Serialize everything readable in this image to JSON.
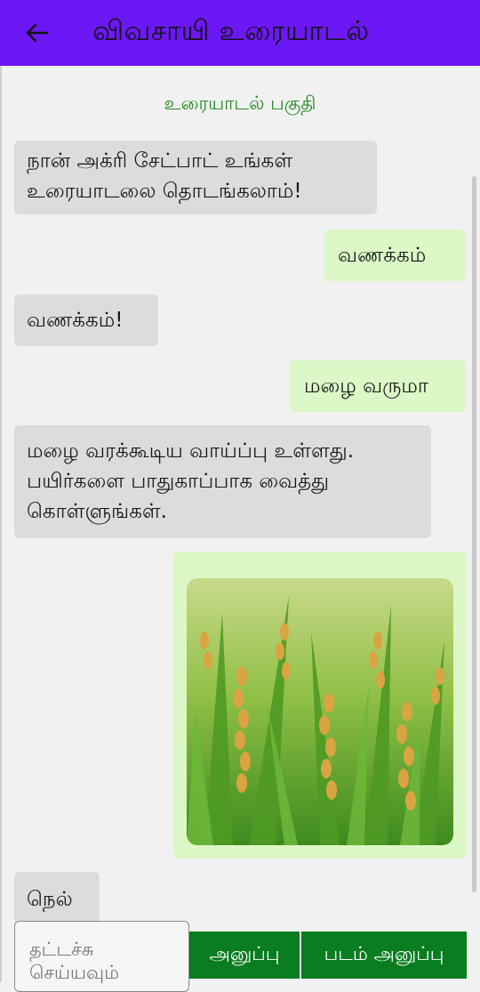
{
  "header": {
    "title": "விவசாயி உரையாடல்",
    "back_icon": "arrow-left-icon",
    "background": "#6c17f5"
  },
  "section_label": "உரையாடல் பகுதி",
  "messages": [
    {
      "sender": "bot",
      "text": "நான் அக்ரி சேட்பாட் உங்கள் உரையாடலை  தொடங்கலாம்!"
    },
    {
      "sender": "user",
      "text": "வணக்கம்"
    },
    {
      "sender": "bot",
      "text": "வணக்கம்!"
    },
    {
      "sender": "user",
      "text": "மழை வருமா"
    },
    {
      "sender": "bot",
      "text": "மழை வரக்கூடிய வாய்ப்பு உள்ளது. பயிர்களை பாதுகாப்பாக வைத்து கொள்ளுங்கள்."
    },
    {
      "sender": "user",
      "type": "image",
      "image": "rice-paddy-photo"
    },
    {
      "sender": "bot",
      "text": "நெல்"
    }
  ],
  "composer": {
    "placeholder": "தட்டச்சு செய்யவும்",
    "send_label": "அனுப்பு",
    "send_image_label": "படம் அனுப்பு"
  },
  "colors": {
    "accent": "#6c17f5",
    "bot_bubble": "#dcdcdc",
    "user_bubble": "#dcf8c6",
    "button": "#0a7d20",
    "section_label": "#1f8a1f"
  }
}
